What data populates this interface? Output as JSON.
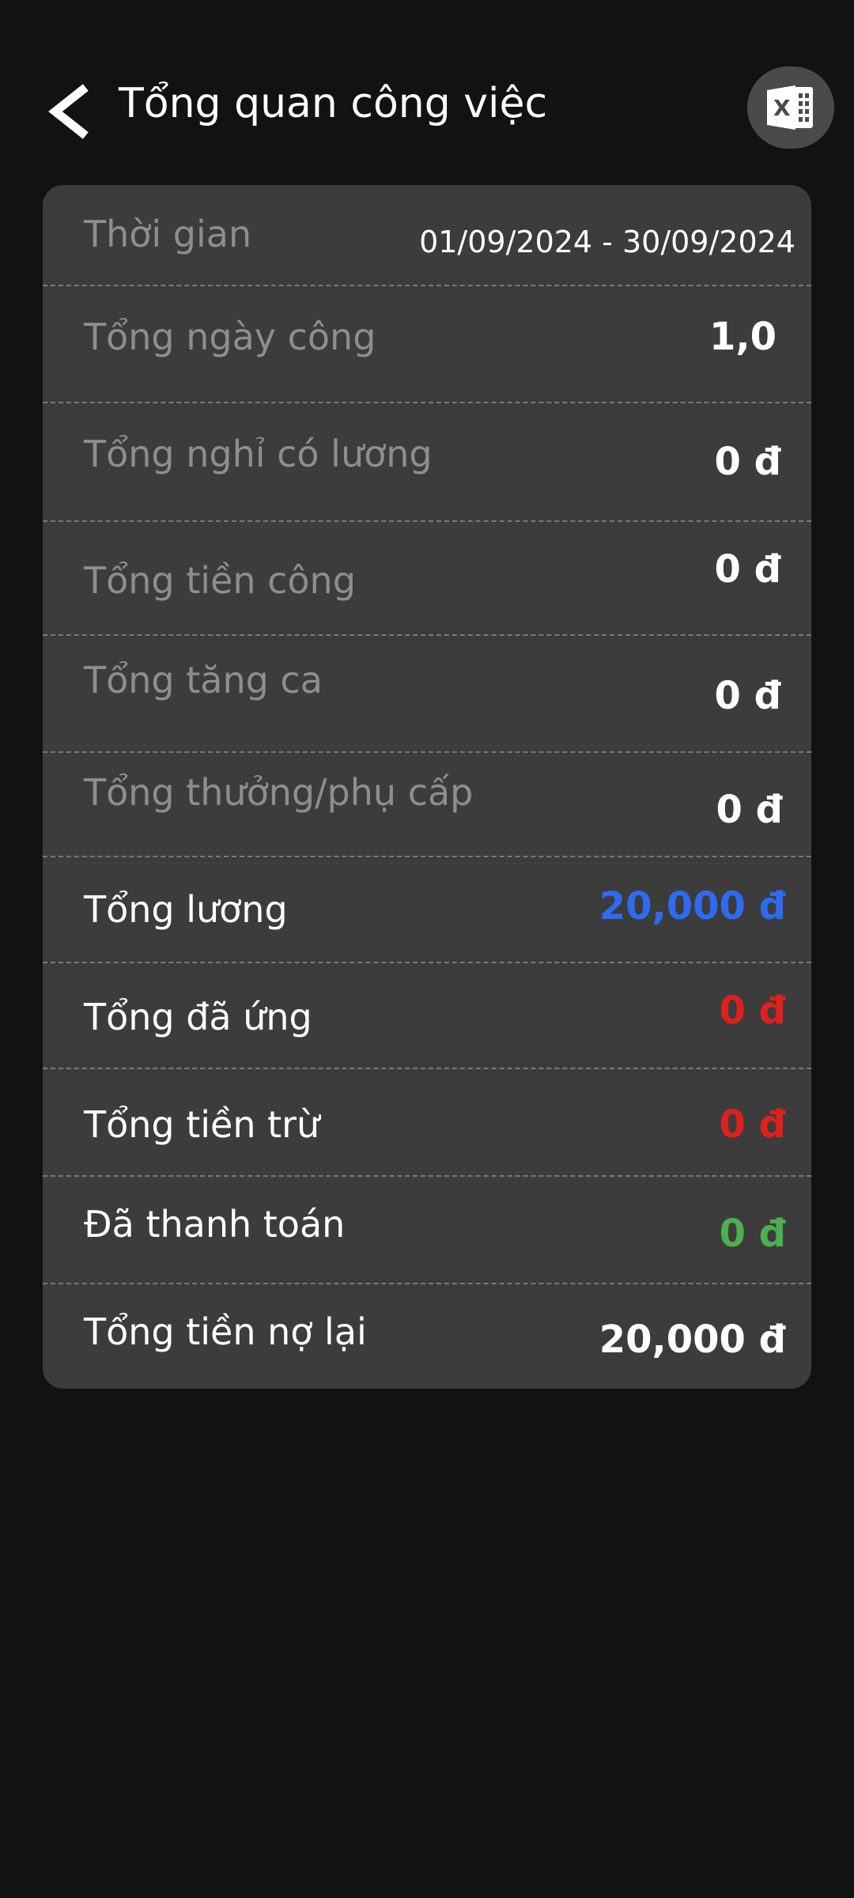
{
  "header": {
    "title": "Tổng quan công việc",
    "back_icon": "chevron-left-icon",
    "export_icon": "excel-icon"
  },
  "summary": {
    "period": {
      "label": "Thời gian",
      "value": "01/09/2024 - 30/09/2024"
    },
    "total_workdays": {
      "label": "Tổng ngày công",
      "value": "1,0"
    },
    "paid_leave": {
      "label": "Tổng nghỉ có lương",
      "value": "0 đ"
    },
    "total_wage": {
      "label": "Tổng tiền công",
      "value": "0 đ"
    },
    "overtime": {
      "label": "Tổng tăng ca",
      "value": "0 đ"
    },
    "bonus_allowance": {
      "label": "Tổng thưởng/phụ cấp",
      "value": "0 đ"
    },
    "total_salary": {
      "label": "Tổng lương",
      "value": "20,000 đ",
      "color": "#2d6cf0"
    },
    "advanced": {
      "label": "Tổng đã ứng",
      "value": "0 đ",
      "color": "#e0201c"
    },
    "deductions": {
      "label": "Tổng tiền trừ",
      "value": "0 đ",
      "color": "#e0201c"
    },
    "paid": {
      "label": "Đã thanh toán",
      "value": "0 đ",
      "color": "#4caf50"
    },
    "remaining_debt": {
      "label": "Tổng tiền nợ lại",
      "value": "20,000 đ"
    }
  }
}
